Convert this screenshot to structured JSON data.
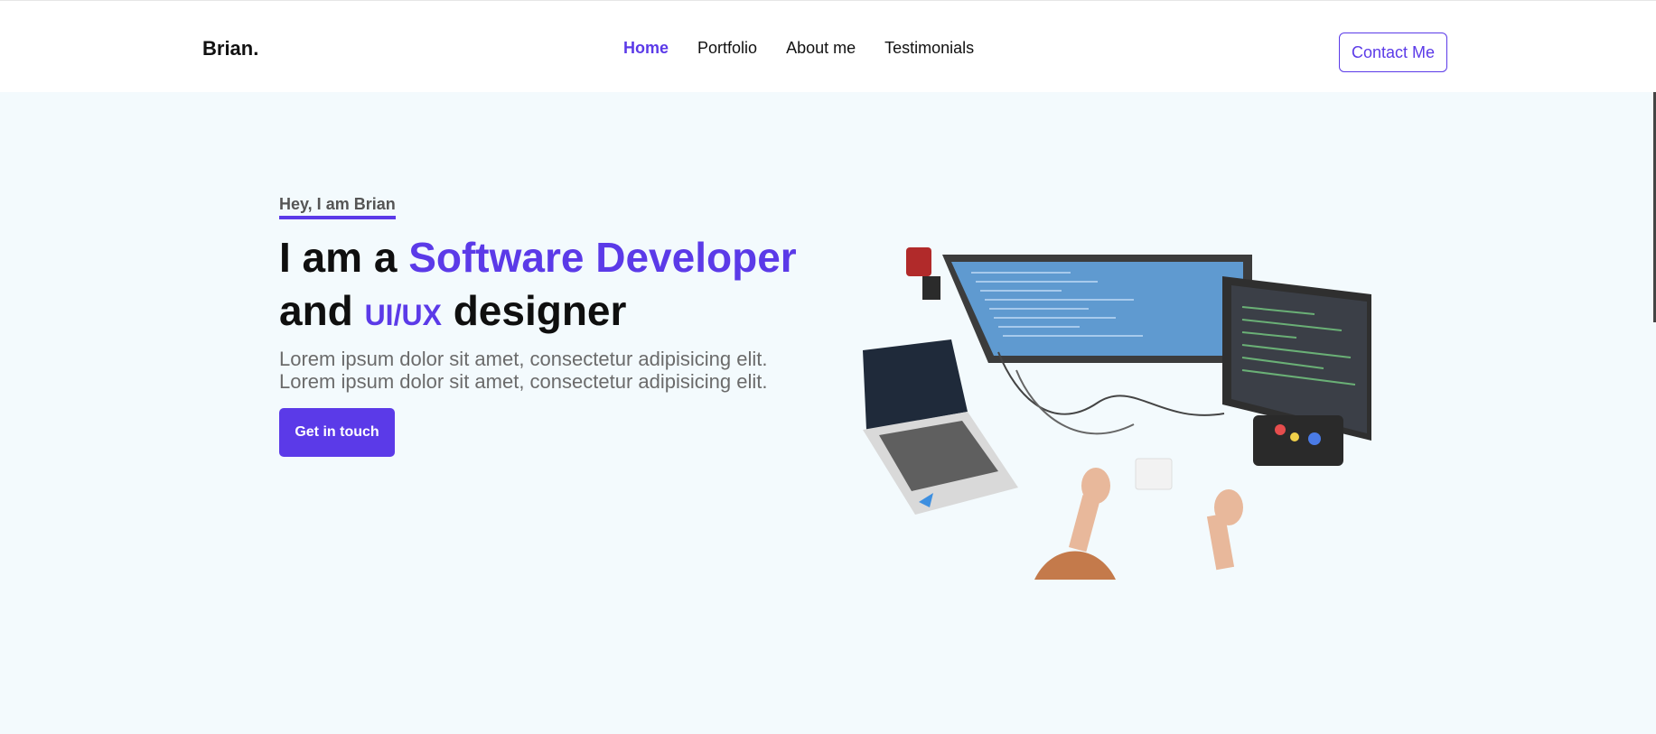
{
  "nav": {
    "brand": "Brian.",
    "links": [
      "Home",
      "Portfolio",
      "About me",
      "Testimonials"
    ],
    "active_link": "Home",
    "contact_label": "Contact Me"
  },
  "hero": {
    "greeting": "Hey, I am Brian",
    "headline_prefix": "I am a",
    "headline_accent": "Software Developer",
    "headline_line2_start": "and",
    "headline_line2_accent": "UI/UX",
    "headline_line2_end": "designer",
    "description_line1": "Lorem ipsum dolor sit amet, consectetur adipisicing elit.",
    "description_line2": "Lorem ipsum dolor sit amet, consectetur adipisicing elit.",
    "cta_label": "Get in touch"
  },
  "colors": {
    "accent": "#5b3ae8",
    "hero_background": "#f3fafd",
    "text_dark": "#0f0f0f",
    "text_muted": "#6b6b6b"
  },
  "image": {
    "subject": "Top-down view of a developer workspace with monitors, laptop and hands"
  }
}
